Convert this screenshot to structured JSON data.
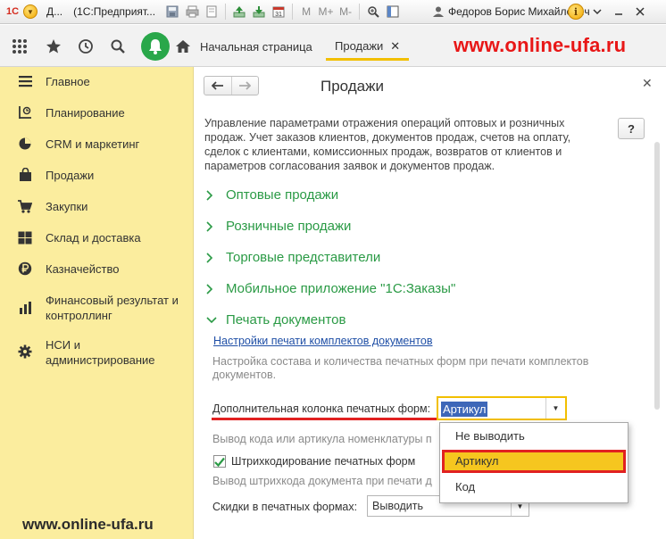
{
  "window": {
    "title_short": "Д...",
    "app_title": "(1С:Предприят...",
    "user": "Федоров Борис Михайлович",
    "logo_text": "1С"
  },
  "toolbar_icons": [
    "save-icon",
    "print-icon",
    "preview-icon",
    "upload-icon",
    "download-icon",
    "calendar-icon",
    "m-icon",
    "m-plus-icon",
    "m-minus-icon",
    "zoom-icon",
    "panel-icon",
    "user-icon",
    "info-icon",
    "chevron-down-icon",
    "minimize-icon",
    "close-icon"
  ],
  "calendar_day": "31",
  "memory_labels": {
    "m": "M",
    "m_plus": "M+",
    "m_minus": "M-"
  },
  "tabs": {
    "home": "Начальная страница",
    "sales": "Продажи"
  },
  "watermarks": {
    "top": "www.online-ufa.ru",
    "bottom": "www.online-ufa.ru"
  },
  "sidebar": {
    "items": [
      {
        "label": "Главное",
        "icon": "menu-lines-icon"
      },
      {
        "label": "Планирование",
        "icon": "planning-icon"
      },
      {
        "label": "CRM и маркетинг",
        "icon": "crm-pie-icon"
      },
      {
        "label": "Продажи",
        "icon": "bag-icon"
      },
      {
        "label": "Закупки",
        "icon": "cart-icon"
      },
      {
        "label": "Склад и доставка",
        "icon": "warehouse-icon"
      },
      {
        "label": "Казначейство",
        "icon": "ruble-icon"
      },
      {
        "label": "Финансовый результат и контроллинг",
        "icon": "bar-chart-icon"
      },
      {
        "label": "НСИ и администрирование",
        "icon": "gear-icon"
      }
    ]
  },
  "page": {
    "title": "Продажи",
    "help": "?",
    "description": "Управление параметрами отражения операций оптовых и розничных продаж. Учет заказов клиентов, документов продаж, счетов на оплату, сделок с клиентами, комиссионных продаж, возвратов от клиентов и параметров согласования заявок и документов продаж.",
    "groups": [
      "Оптовые продажи",
      "Розничные продажи",
      "Торговые представители",
      "Мобильное приложение \"1С:Заказы\"",
      "Печать документов"
    ],
    "print": {
      "link": "Настройки печати комплектов документов",
      "link_hint": "Настройка состава и количества печатных форм при печати комплектов документов.",
      "extra_column_label": "Дополнительная колонка печатных форм:",
      "extra_column_value": "Артикул",
      "extra_column_hint": "Вывод кода или артикула номенклатуры п",
      "barcode_label": "Штрихкодирование печатных форм",
      "barcode_checked": true,
      "barcode_hint": "Вывод штрихкода документа при печати д",
      "discounts_label": "Скидки в печатных формах:",
      "discounts_value": "Выводить"
    }
  },
  "dropdown": {
    "options": [
      "Не выводить",
      "Артикул",
      "Код"
    ],
    "selected": "Артикул"
  },
  "colors": {
    "sidebar_bg": "#fbed9e",
    "accent_yellow": "#f2bf00",
    "group_green": "#2a9a45",
    "link_blue": "#1f4fa6",
    "highlight_red": "#e12121",
    "bell_green": "#29a74a"
  }
}
